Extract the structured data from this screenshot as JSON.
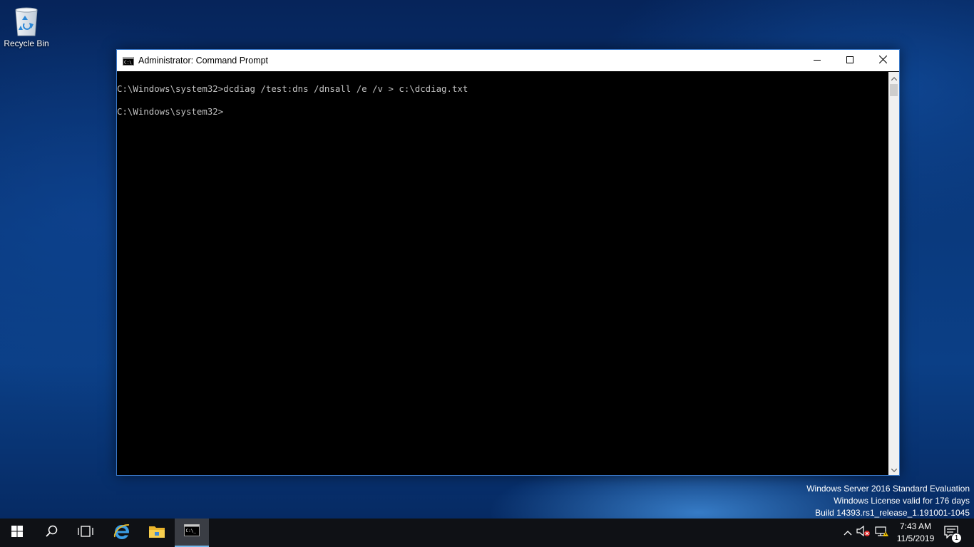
{
  "desktop": {
    "recycle_bin_label": "Recycle Bin"
  },
  "window": {
    "title": "Administrator: Command Prompt",
    "icon": "cmd-icon",
    "console_lines": [
      "C:\\Windows\\system32>dcdiag /test:dns /dnsall /e /v > c:\\dcdiag.txt",
      "C:\\Windows\\system32>"
    ]
  },
  "watermark": {
    "line1": "Windows Server 2016 Standard Evaluation",
    "line2": "Windows License valid for 176 days",
    "line3": "Build 14393.rs1_release_1.191001-1045"
  },
  "taskbar": {
    "clock_time": "7:43 AM",
    "clock_date": "11/5/2019",
    "notification_count": "1",
    "pinned": [
      "start-icon",
      "search-icon",
      "task-view-icon",
      "internet-explorer-icon",
      "file-explorer-icon",
      "command-prompt-icon"
    ]
  },
  "colors": {
    "console_bg": "#000000",
    "console_fg": "#c0c0c0",
    "window_border": "#3a78c8",
    "taskbar_bg": "#0f1115",
    "active_indicator": "#76b9ed"
  }
}
